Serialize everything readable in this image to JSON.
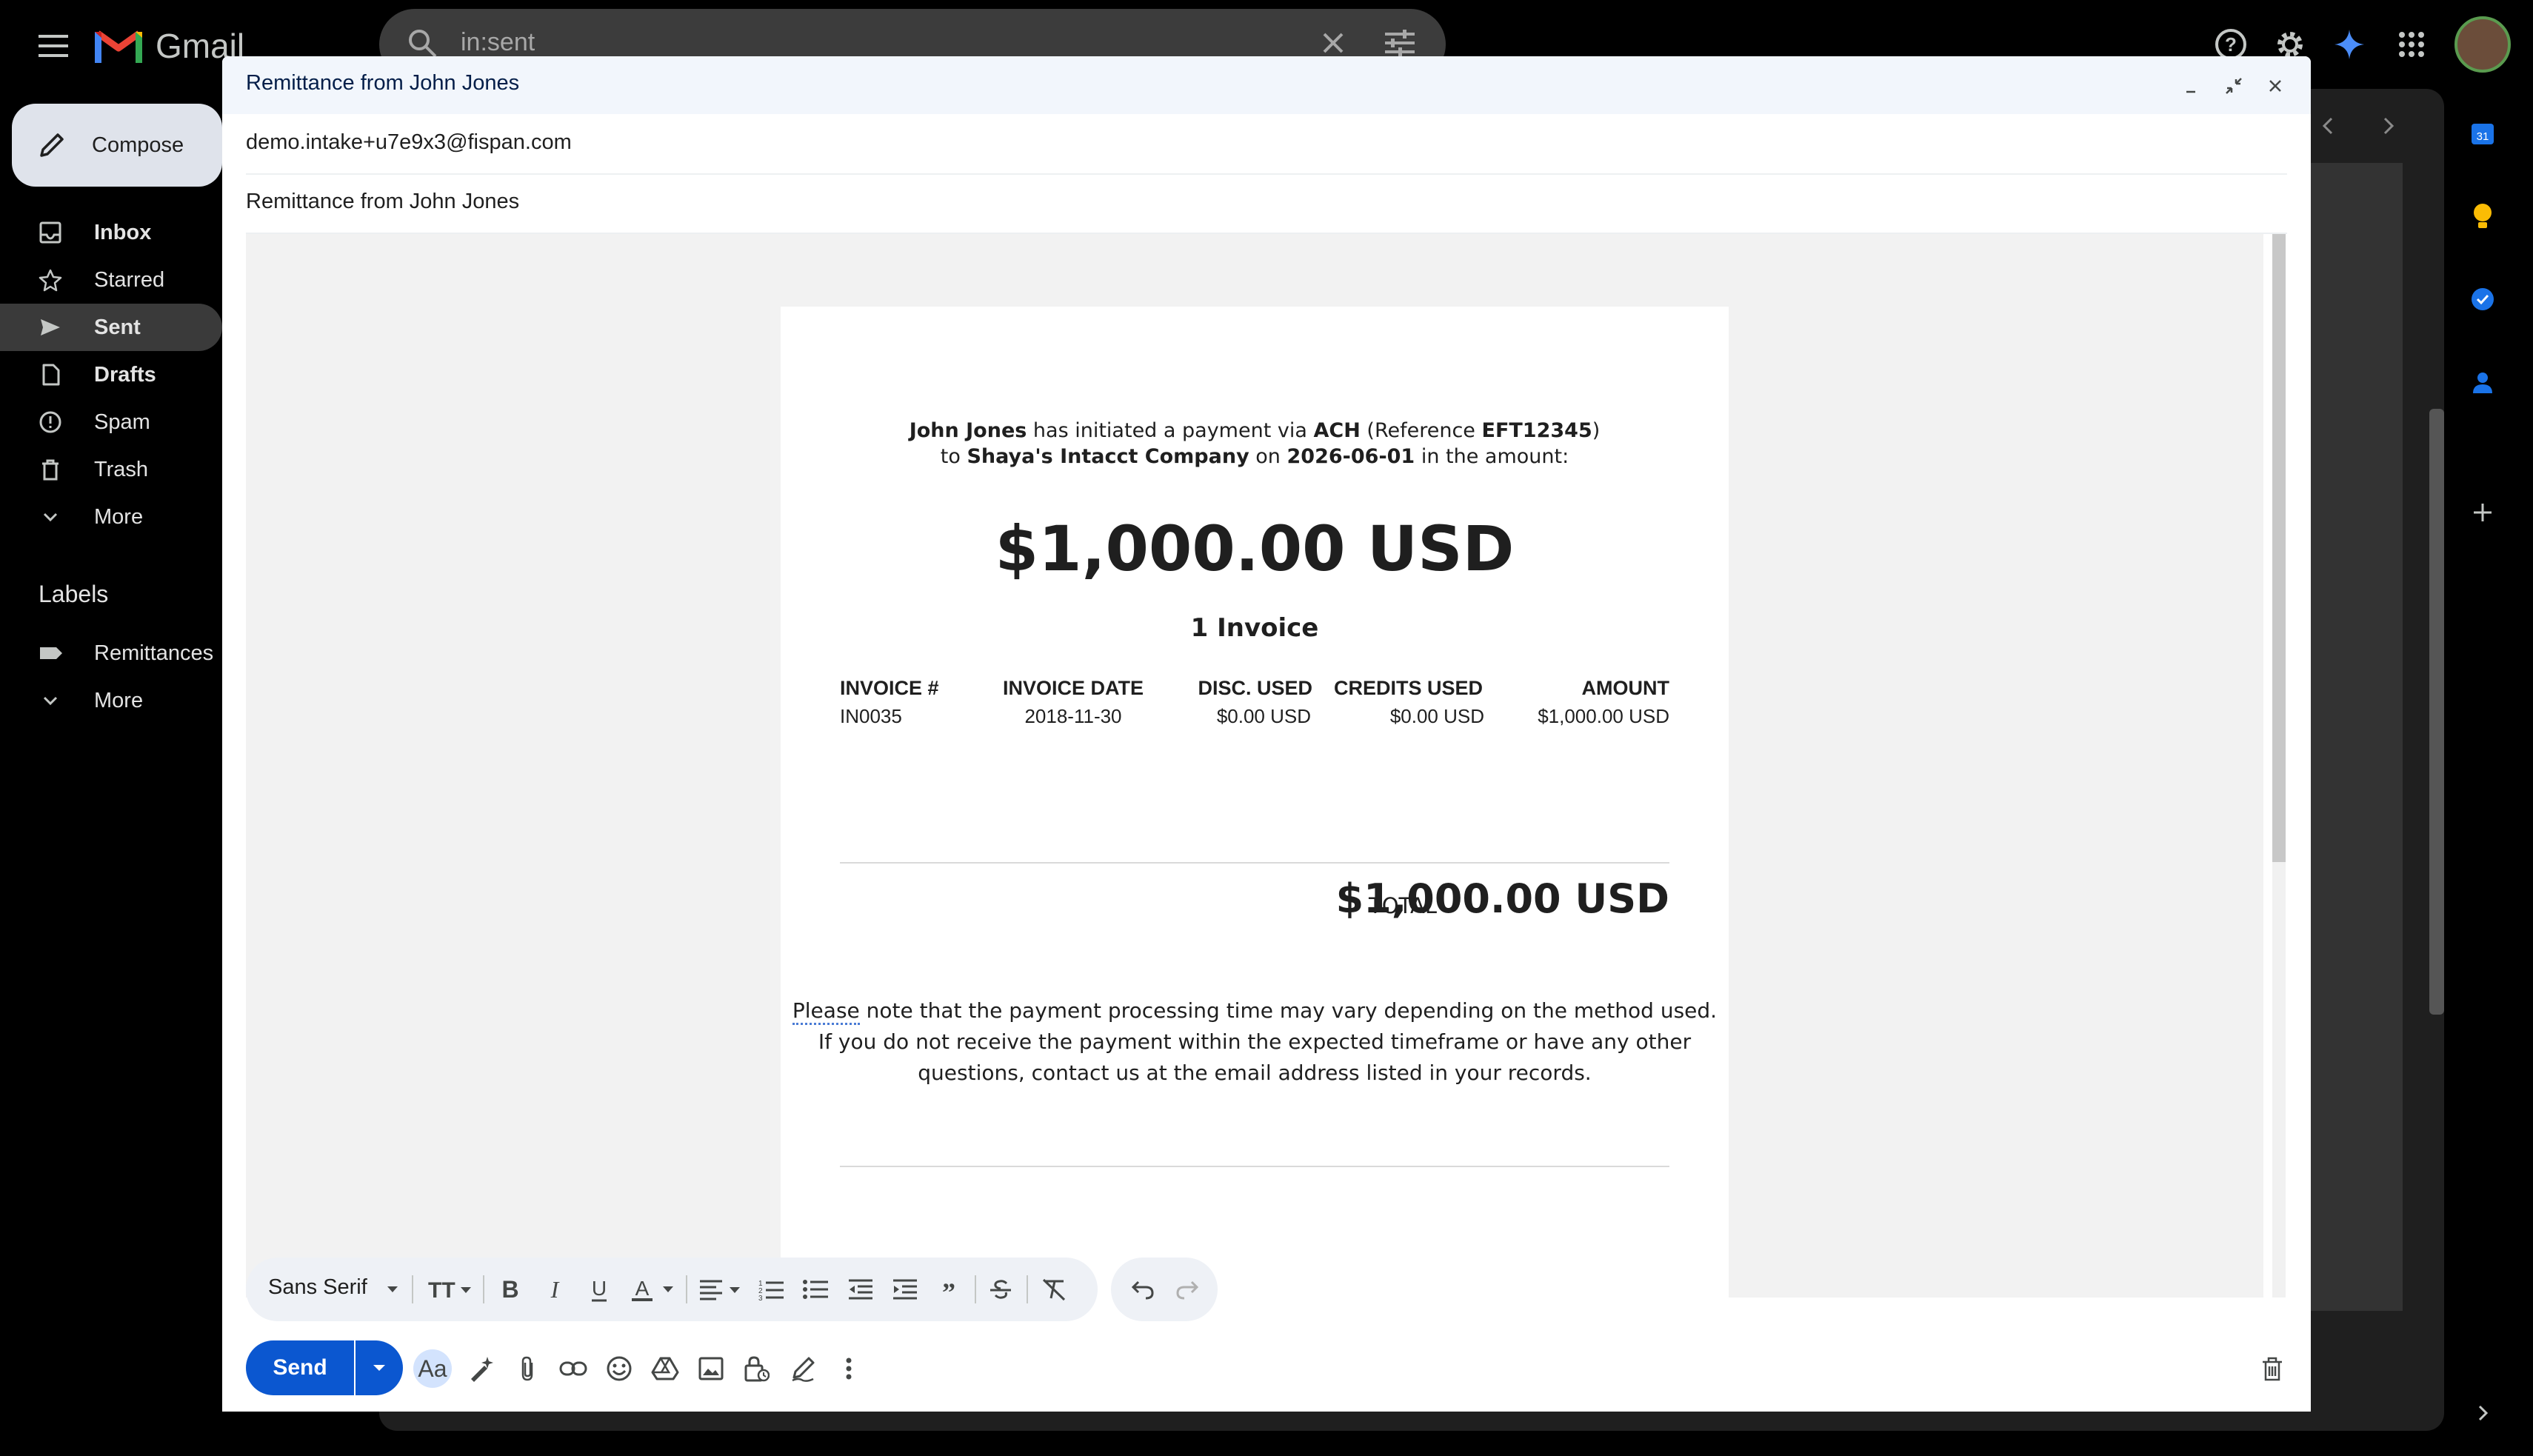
{
  "app": {
    "name": "Gmail",
    "search_value": "in:sent"
  },
  "sidebar": {
    "compose_label": "Compose",
    "items": [
      {
        "label": "Inbox",
        "icon": "inbox-icon"
      },
      {
        "label": "Starred",
        "icon": "star-icon"
      },
      {
        "label": "Sent",
        "icon": "send-icon",
        "active": true
      },
      {
        "label": "Drafts",
        "icon": "draft-icon"
      },
      {
        "label": "Spam",
        "icon": "spam-icon"
      },
      {
        "label": "Trash",
        "icon": "trash-icon"
      },
      {
        "label": "More",
        "icon": "chevron-down-icon"
      }
    ],
    "labels_heading": "Labels",
    "labels": [
      {
        "label": "Remittances",
        "icon": "label-icon"
      },
      {
        "label": "More",
        "icon": "chevron-down-icon"
      }
    ]
  },
  "compose": {
    "title": "Remittance from John Jones",
    "to": "demo.intake+u7e9x3@fispan.com",
    "subject": "Remittance from John Jones",
    "send_label": "Send",
    "font_family_value": "Sans Serif"
  },
  "email": {
    "intro": {
      "payer": "John Jones",
      "t1": "has initiated a payment via",
      "method": "ACH",
      "t2": "(Reference",
      "reference": "EFT12345",
      "t3": ")",
      "t4": "to",
      "payee": "Shaya's Intacct Company",
      "t5": "on",
      "date": "2026-06-01",
      "t6": "in the amount:"
    },
    "amount": "$1,000.00 USD",
    "invoice_count": "1 Invoice",
    "table": {
      "headers": [
        "INVOICE #",
        "INVOICE DATE",
        "DISC. USED",
        "CREDITS USED",
        "AMOUNT"
      ],
      "rows": [
        [
          "IN0035",
          "2018-11-30",
          "$0.00 USD",
          "$0.00 USD",
          "$1,000.00 USD"
        ]
      ]
    },
    "total_label": "TOTAL",
    "total_value": "$1,000.00 USD",
    "note": {
      "first_word": "Please",
      "line1_rest": "note that the payment processing time may vary depending on the method used.",
      "line2": "If you do not receive the payment within the expected timeframe or have any other",
      "line3": "questions, contact us at the email address listed in your records."
    }
  },
  "colors": {
    "send_blue": "#0b57d0",
    "header_bg": "#f2f6fc",
    "page_bg": "#000000"
  }
}
